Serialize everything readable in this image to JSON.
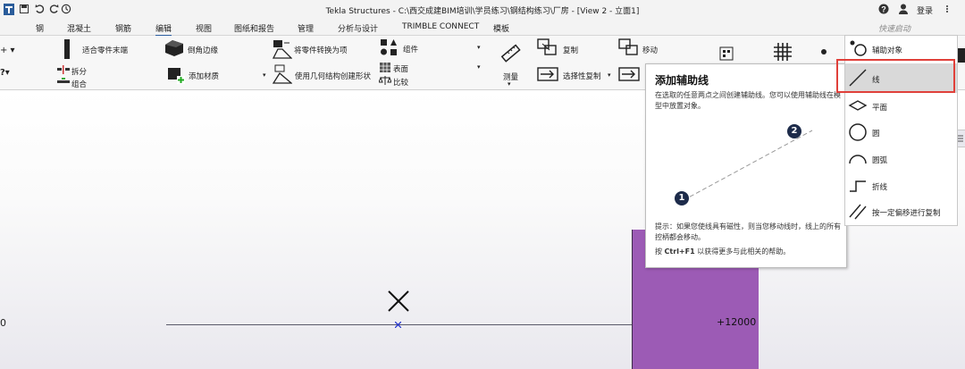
{
  "window": {
    "title": "Tekla Structures - C:\\西交成建BIM培训\\学员练习\\钢结构练习\\厂房 - [View 2 - 立面1]",
    "login_label": "登录",
    "quick_launch_placeholder": "快速启动"
  },
  "menu": {
    "items": [
      "钢",
      "混凝土",
      "钢筋",
      "编辑",
      "视图",
      "图纸和报告",
      "管理",
      "分析与设计",
      "TRIMBLE CONNECT",
      "模板"
    ],
    "active": "编辑"
  },
  "ribbon": {
    "fit_end": "适合零件末端",
    "split": "拆分",
    "combine": "组合",
    "chamfer": "倒角边缘",
    "add_material": "添加材质",
    "convert_part": "将零件转换为项",
    "geom_create": "使用几何结构创建形状",
    "component": "组件",
    "surface": "表面",
    "compare": "比较",
    "measure": "测量",
    "copy": "复制",
    "selective_copy": "选择性复制",
    "move": "移动"
  },
  "tooltip": {
    "title": "添加辅助线",
    "description": "在选取的任意两点之间创建辅助线。您可以使用辅助线在模型中放置对象。",
    "tip": "提示：如果您使线具有磁性，则当您移动线时，线上的所有控柄都会移动。",
    "help_prefix": "按",
    "help_key": "Ctrl+F1",
    "help_suffix": "以获得更多与此相关的帮助。",
    "point1": "1",
    "point2": "2"
  },
  "dropdown": {
    "items": [
      "辅助对象",
      "线",
      "平面",
      "圆",
      "圆弧",
      "折线",
      "按一定偏移进行复制"
    ],
    "selected": "线"
  },
  "canvas": {
    "left_coord": "0",
    "right_coord": "+12000"
  }
}
